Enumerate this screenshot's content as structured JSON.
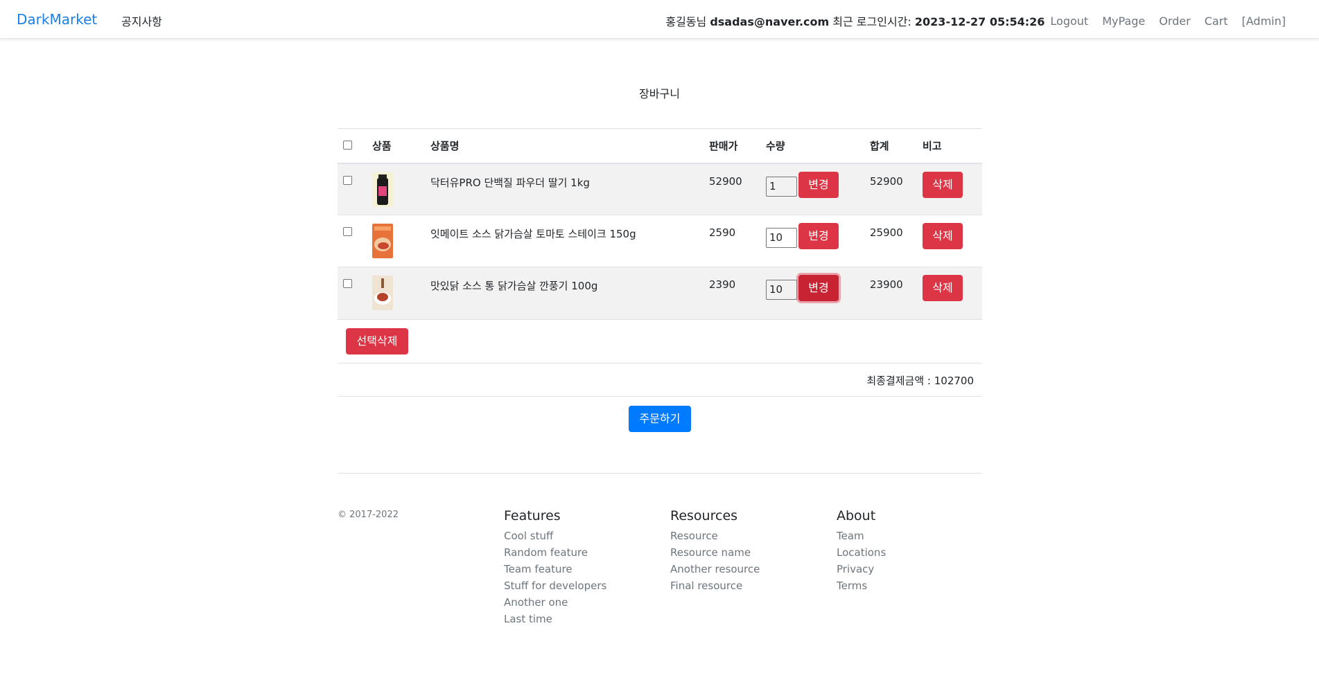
{
  "nav": {
    "brand": "DarkMarket",
    "notice": "공지사항",
    "user_name": "홍길동님",
    "user_email": "dsadas@naver.com",
    "last_login_label": "최근 로그인시간:",
    "last_login_time": "2023-12-27 05:54:26",
    "links": [
      "Logout",
      "MyPage",
      "Order",
      "Cart",
      "[Admin]"
    ]
  },
  "cart": {
    "title": "장바구니",
    "headers": {
      "product": "상품",
      "name": "상품명",
      "price": "판매가",
      "qty": "수량",
      "total": "합계",
      "note": "비고"
    },
    "change_label": "변경",
    "delete_label": "삭제",
    "items": [
      {
        "name": "닥터유PRO 단백질 파우더 딸기 1kg",
        "price": "52900",
        "qty": "1",
        "total": "52900"
      },
      {
        "name": "잇메이트 소스 닭가슴살 토마토 스테이크 150g",
        "price": "2590",
        "qty": "10",
        "total": "25900"
      },
      {
        "name": "맛있닭 소스 통 닭가슴살 깐풍기 100g",
        "price": "2390",
        "qty": "10",
        "total": "23900"
      }
    ],
    "select_delete_label": "선택삭제",
    "final_amount_label": "최종결제금액 : 102700",
    "order_label": "주문하기"
  },
  "footer": {
    "copyright": "© 2017-2022",
    "features": {
      "title": "Features",
      "items": [
        "Cool stuff",
        "Random feature",
        "Team feature",
        "Stuff for developers",
        "Another one",
        "Last time"
      ]
    },
    "resources": {
      "title": "Resources",
      "items": [
        "Resource",
        "Resource name",
        "Another resource",
        "Final resource"
      ]
    },
    "about": {
      "title": "About",
      "items": [
        "Team",
        "Locations",
        "Privacy",
        "Terms"
      ]
    }
  },
  "colors": {
    "brand": "#1a7fe6",
    "danger": "#dc3545",
    "primary": "#007bff"
  }
}
